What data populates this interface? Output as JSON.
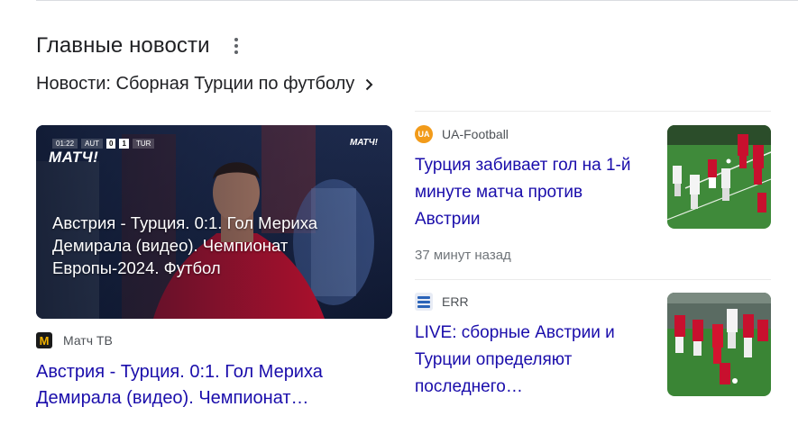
{
  "header": {
    "title": "Главные новости",
    "menu_icon": "more-vert-icon"
  },
  "topic": {
    "label": "Новости: Сборная Турции по футболу",
    "icon": "chevron-right-icon"
  },
  "main_story": {
    "thumbnail": {
      "brand": "МАТЧ!",
      "brand_small": "МАТЧ!",
      "scorebar": {
        "time": "01:22",
        "team1": "AUT",
        "score1": "0",
        "score2": "1",
        "team2": "TUR"
      },
      "caption": "Австрия - Турция. 0:1. Гол Мериха Демирала (видео). Чемпионат Европы-2024. Футбол"
    },
    "source": "Матч ТВ",
    "favicon_letter": "M",
    "headline": "Австрия - Турция. 0:1. Гол Мериха Демирала (видео). Чемпионат…"
  },
  "side_stories": [
    {
      "source": "UA-Football",
      "favicon_text": "UA",
      "headline": "Турция забивает гол на 1-й минуте матча против Австрии",
      "time": "37 минут назад"
    },
    {
      "source": "ERR",
      "headline": "LIVE: сборные Австрии и Турции определяют последнего…"
    }
  ],
  "colors": {
    "link": "#1a0dab",
    "meta": "#70757a",
    "source": "#4d5156",
    "turkey_red": "#c8102e",
    "pitch_green": "#3f8a3a"
  }
}
